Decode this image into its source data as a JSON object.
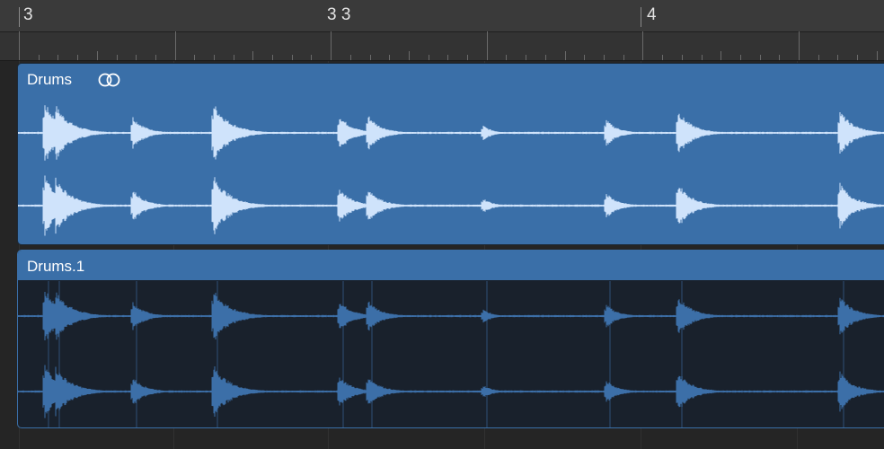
{
  "ruler": {
    "labels": [
      "3",
      "3 3",
      "4"
    ]
  },
  "regions": [
    {
      "name": "Drums",
      "icon": "link-icon",
      "color": "#3a6fa8",
      "wave_color": "#cfe3fb",
      "selected": true
    },
    {
      "name": "Drums.1",
      "color": "#19212c",
      "wave_color": "#3c6fa8",
      "selected": false
    }
  ],
  "colors": {
    "ruler_bg": "#3a3a3a",
    "region_blue": "#3a6fa8",
    "region_dark": "#19212c",
    "waveform_light": "#cfe3fb",
    "waveform_dark": "#3c6fa8"
  }
}
